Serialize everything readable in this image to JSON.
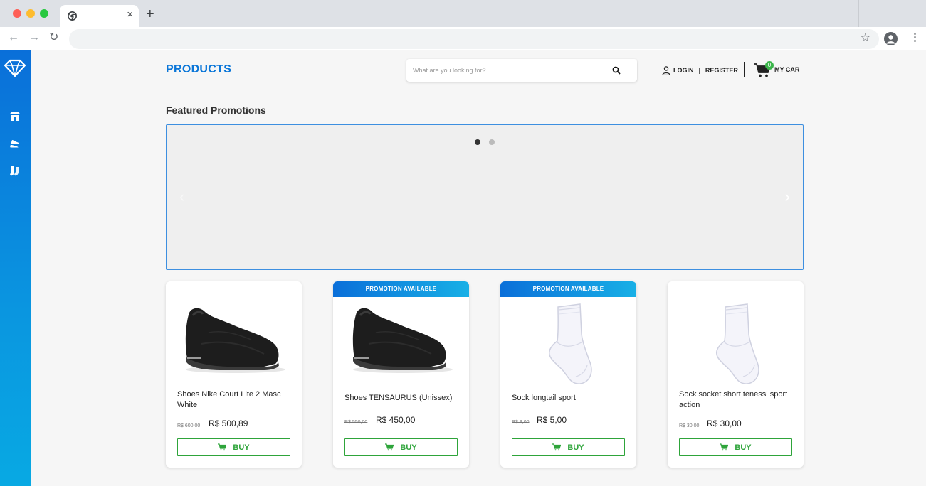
{
  "browser": {
    "close_tab": "×",
    "new_tab": "+",
    "back": "←",
    "forward": "→",
    "reload": "↻",
    "bookmark": "☆",
    "menu": "⋮"
  },
  "sidebar": {
    "items": [
      {
        "icon": "diamond-logo-icon"
      },
      {
        "icon": "store-icon"
      },
      {
        "icon": "shoes-icon"
      },
      {
        "icon": "socks-icon"
      }
    ]
  },
  "header": {
    "title": "PRODUCTS",
    "search_placeholder": "What are you looking for?",
    "login": "LOGIN",
    "separator": "|",
    "register": "REGISTER",
    "cart_count": "0",
    "cart_label": "MY CAR"
  },
  "featured": {
    "title": "Featured Promotions",
    "prev": "‹",
    "next": "›"
  },
  "products": [
    {
      "name": "Shoes Nike Court Lite 2 Masc White",
      "old_price": "R$ 600,00",
      "price": "R$ 500,89",
      "promo": "",
      "buy": "BUY",
      "image": "black-shoe"
    },
    {
      "name": "Shoes TENSAURUS (Unissex)",
      "old_price": "R$ 550,00",
      "price": "R$ 450,00",
      "promo": "PROMOTION AVAILABLE",
      "buy": "BUY",
      "image": "black-shoe"
    },
    {
      "name": "Sock longtail sport",
      "old_price": "R$ 9,00",
      "price": "R$ 5,00",
      "promo": "PROMOTION AVAILABLE",
      "buy": "BUY",
      "image": "white-sock"
    },
    {
      "name": "Sock socket short tenessi sport action",
      "old_price": "R$ 30,00",
      "price": "R$ 30,00",
      "promo": "",
      "buy": "BUY",
      "image": "white-sock"
    }
  ],
  "colors": {
    "brand_blue": "#0a76d8",
    "buy_green": "#2ea43a",
    "badge_green": "#3ab54a"
  }
}
